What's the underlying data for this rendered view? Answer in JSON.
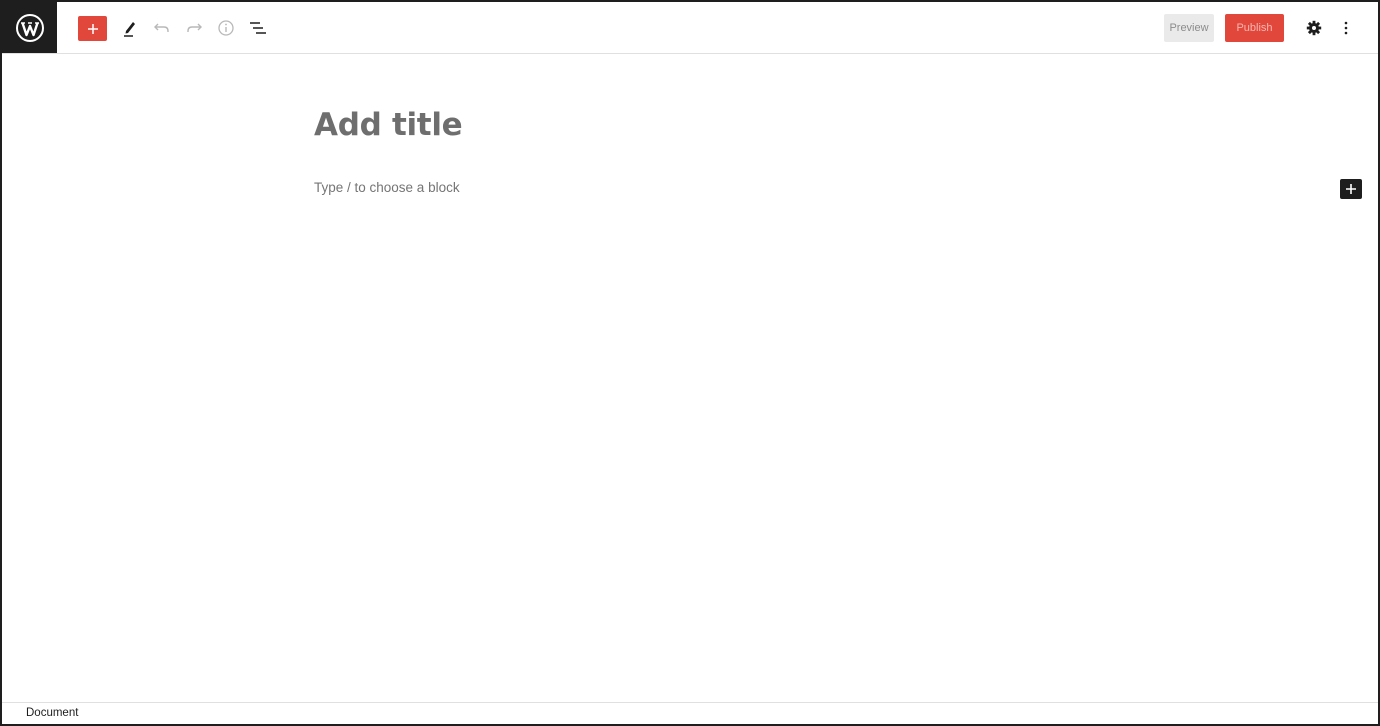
{
  "colors": {
    "accent": "#e2473b",
    "dark": "#1e1e1e",
    "placeholder": "#757575"
  },
  "header": {
    "logo_icon": "wordpress-icon",
    "inserter_icon": "plus-icon",
    "tools": [
      {
        "name": "edit-icon"
      },
      {
        "name": "undo-icon"
      },
      {
        "name": "redo-icon"
      },
      {
        "name": "info-icon"
      },
      {
        "name": "list-view-icon"
      }
    ],
    "preview_label": "Preview",
    "publish_label": "Publish",
    "settings_icon": "gear-icon",
    "more_icon": "more-vertical-icon"
  },
  "editor": {
    "title_placeholder": "Add title",
    "block_placeholder": "Type / to choose a block",
    "block_inserter_icon": "plus-icon"
  },
  "footer": {
    "breadcrumb": "Document"
  }
}
